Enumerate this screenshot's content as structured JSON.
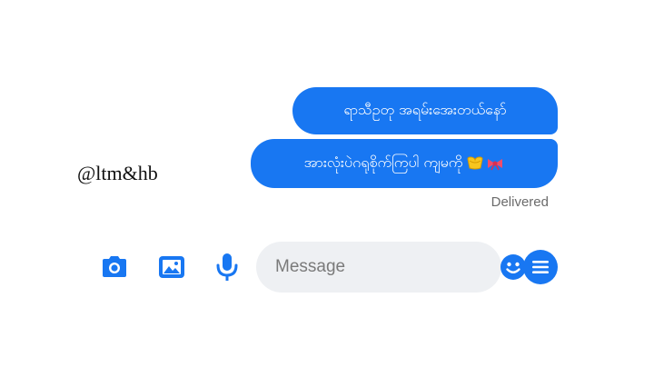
{
  "watermark": "@ltm&hb",
  "messages": [
    {
      "text": "ရာသီဥတု အရမ်းအေးတယ်နော်",
      "emoji": []
    },
    {
      "text": "အားလုံးပဲဂရုစိုက်ကြပါ ကျမကို",
      "emoji": [
        "yellow-heart",
        "ribbon"
      ]
    }
  ],
  "status": "Delivered",
  "composer": {
    "placeholder": "Message"
  },
  "icons": {
    "camera": "camera-icon",
    "gallery": "image-icon",
    "mic": "microphone-icon",
    "emoji": "smiley-icon",
    "menu": "menu-icon"
  },
  "colors": {
    "accent": "#1877f2",
    "bubble_text": "#ffffff",
    "input_bg": "#eef0f3",
    "status_text": "#6b6b6b"
  }
}
